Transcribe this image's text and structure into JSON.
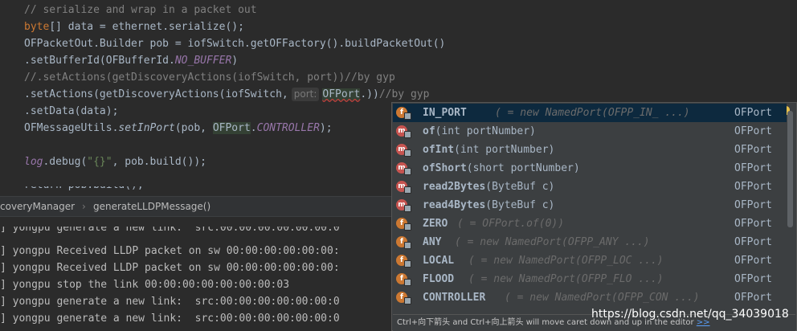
{
  "editor": {
    "lines": [
      {
        "comment": "// serialize and wrap in a packet out"
      },
      {
        "kw": "byte",
        "rest": "[] data = ethernet.serialize();"
      },
      {
        "text": "OFPacketOut.Builder pob = iofSwitch.getOFFactory().buildPacketOut()"
      },
      {
        "pre": ".setBufferId(OFBufferId.",
        "const": "NO_BUFFER",
        "post": ")"
      },
      {
        "comment": "//.setActions(getDiscoveryActions(iofSwitch, port))//by gyp"
      },
      {
        "pre": ".setActions(getDiscoveryActions(iofSwitch,",
        "hint": "port:",
        "err": "OFPort",
        "post": ".))",
        "tail": "//by gyp"
      },
      {
        "text": ".setData(data);"
      },
      {
        "pre": "OFMessageUtils.",
        "ital": "setInPort",
        "mid": "(pob, ",
        "hl": "OFPort",
        "dot": ".",
        "const": "CONTROLLER",
        "post": ");"
      },
      {
        "text": ""
      },
      {
        "ital": "log",
        "mid": ".debug(",
        "str": "\"{}\"",
        "post": ", pob.build());"
      }
    ],
    "cut": "return pob.build();"
  },
  "breadcrumb": {
    "items": [
      "coveryManager",
      "generateLLDPMessage()"
    ],
    "sep": "›"
  },
  "console": {
    "lines": [
      "] yongpu generate a new link:  src:00:00:00:00:00:00:0",
      "] yongpu Received LLDP packet on sw 00:00:00:00:00:00:",
      "] yongpu Received LLDP packet on sw 00:00:00:00:00:00:",
      "] yongpu stop the link 00:00:00:00:00:00:00:03",
      "] yongpu generate a new link:  src:00:00:00:00:00:00:0",
      "] yongpu generate a new link:  src:00:00:00:00:00:00:0"
    ]
  },
  "popup": {
    "items": [
      {
        "kind": "f",
        "name": "IN_PORT",
        "grey": "( = new NamedPort(OFPP_IN_  ...)",
        "type": "OFPort"
      },
      {
        "kind": "m",
        "name": "of",
        "params": "(int portNumber)",
        "type": "OFPort"
      },
      {
        "kind": "m",
        "name": "ofInt",
        "params": "(int portNumber)",
        "type": "OFPort"
      },
      {
        "kind": "m",
        "name": "ofShort",
        "params": "(short portNumber)",
        "type": "OFPort"
      },
      {
        "kind": "m",
        "name": "read2Bytes",
        "params": "(ByteBuf c)",
        "type": "OFPort"
      },
      {
        "kind": "m",
        "name": "read4Bytes",
        "params": "(ByteBuf c)",
        "type": "OFPort"
      },
      {
        "kind": "f",
        "name": "ZERO",
        "grey": "( = OFPort.of(0))",
        "type": "OFPort"
      },
      {
        "kind": "f",
        "name": "ANY",
        "grey": "( = new NamedPort(OFPP_ANY ...)",
        "type": "OFPort"
      },
      {
        "kind": "f",
        "name": "LOCAL",
        "grey": "( = new NamedPort(OFPP_LOC ...)",
        "type": "OFPort"
      },
      {
        "kind": "f",
        "name": "FLOOD",
        "grey": "( = new NamedPort(OFPP_FLO ...)",
        "type": "OFPort"
      },
      {
        "kind": "f",
        "name": "CONTROLLER",
        "grey": "( = new NamedPort(OFPP_CON ...)",
        "type": "OFPort"
      }
    ],
    "footer_text": "Ctrl+向下箭头 and Ctrl+向上箭头 will move caret down and up in the editor",
    "footer_link": ">>"
  },
  "watermark": "https://blog.csdn.net/qq_34039018",
  "colors": {
    "keyword": "#cc7832",
    "constant": "#9876aa",
    "comment": "#808080",
    "string": "#6a8759",
    "selection": "#0d293e"
  }
}
